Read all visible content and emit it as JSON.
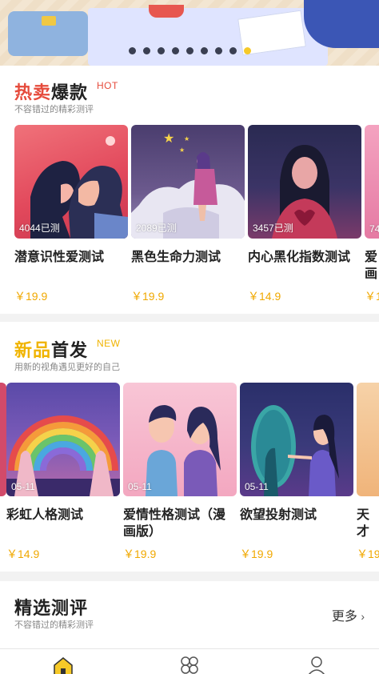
{
  "banner": {
    "dot_count": 9,
    "active_dot": 8
  },
  "hot": {
    "title_accent": "热卖",
    "title_rest": "爆款",
    "tag": "HOT",
    "subtitle": "不容错过的精彩测评",
    "items": [
      {
        "name": "潜意识性爱测试",
        "count": "4044已测",
        "price": "￥19.9"
      },
      {
        "name": "黑色生命力测试",
        "count": "2089已测",
        "price": "￥19.9"
      },
      {
        "name": "内心黑化指数测试",
        "count": "3457已测",
        "price": "￥14.9"
      },
      {
        "name": "爱画",
        "count": "74",
        "price": "￥1"
      }
    ]
  },
  "new": {
    "title_accent": "新品",
    "title_rest": "首发",
    "tag": "NEW",
    "subtitle": "用新的视角遇见更好的自己",
    "items": [
      {
        "name": "彩虹人格测试",
        "date": "05-11",
        "price": "￥14.9"
      },
      {
        "name": "爱情性格测试（漫画版）",
        "date": "05-11",
        "price": "￥19.9"
      },
      {
        "name": "欲望投射测试",
        "date": "05-11",
        "price": "￥19.9"
      },
      {
        "name": "天才",
        "date": "",
        "price": "￥19"
      }
    ]
  },
  "picks": {
    "title": "精选测评",
    "subtitle": "不容错过的精彩测评",
    "more": "更多"
  },
  "tabs": [
    {
      "icon": "home-icon",
      "active": true
    },
    {
      "icon": "grid-icon",
      "active": false
    },
    {
      "icon": "user-icon",
      "active": false
    }
  ],
  "colors": {
    "hot_accent": "#e64b3c",
    "new_accent": "#f0b400",
    "price": "#f0a800",
    "active_dot": "#f6c928"
  }
}
